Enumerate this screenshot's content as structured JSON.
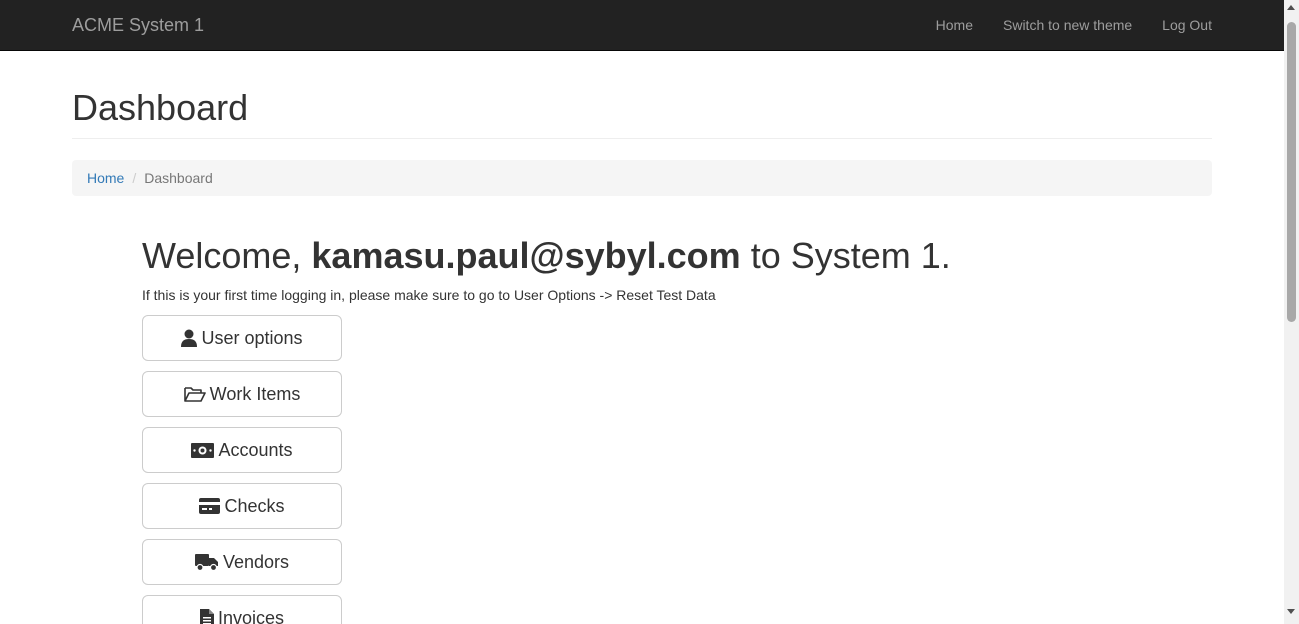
{
  "navbar": {
    "brand": "ACME System 1",
    "links": [
      {
        "label": "Home"
      },
      {
        "label": "Switch to new theme"
      },
      {
        "label": "Log Out"
      }
    ]
  },
  "page": {
    "title": "Dashboard"
  },
  "breadcrumb": {
    "home": "Home",
    "current": "Dashboard"
  },
  "welcome": {
    "prefix": "Welcome,",
    "email": "kamasu.paul@sybyl.com",
    "suffix": "to System 1.",
    "hint": "If this is your first time logging in, please make sure to go to User Options -> Reset Test Data"
  },
  "menu": [
    {
      "label": "User options",
      "icon": "user-icon"
    },
    {
      "label": "Work Items",
      "icon": "folder-open-icon"
    },
    {
      "label": "Accounts",
      "icon": "money-bill-icon"
    },
    {
      "label": "Checks",
      "icon": "credit-card-icon"
    },
    {
      "label": "Vendors",
      "icon": "truck-icon"
    },
    {
      "label": "Invoices",
      "icon": "file-alt-icon"
    }
  ],
  "colors": {
    "navbar_bg": "#222222",
    "navbar_text": "#9d9d9d",
    "link": "#337ab7",
    "breadcrumb_bg": "#f5f5f5"
  }
}
